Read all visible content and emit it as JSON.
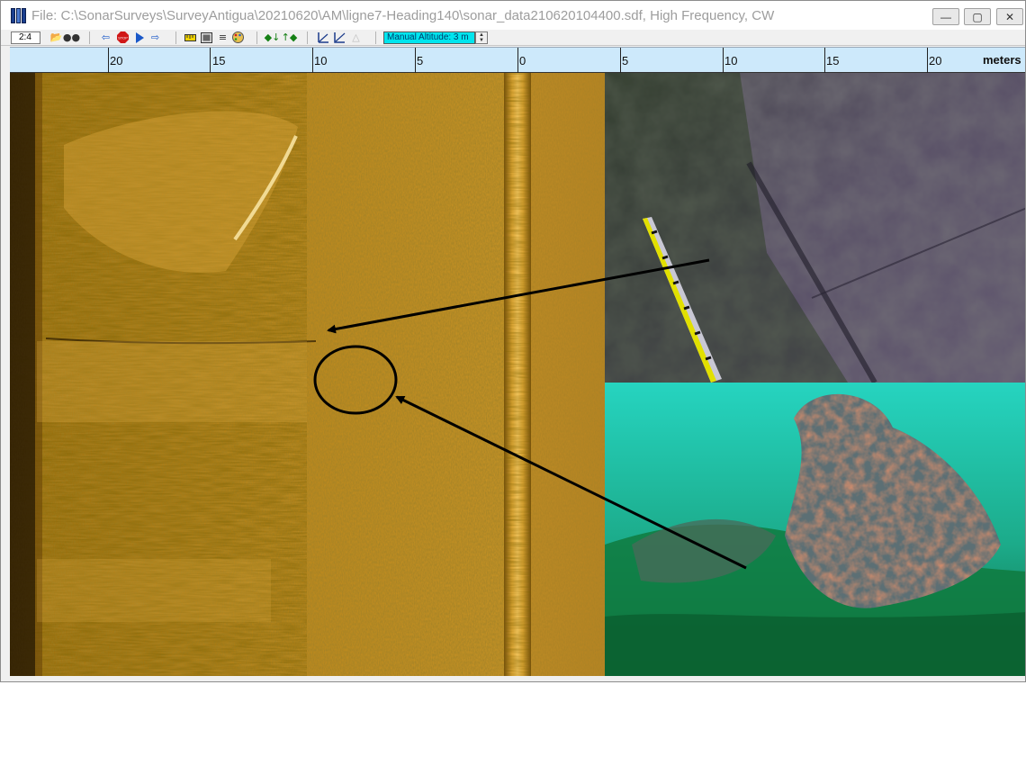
{
  "window": {
    "title": "File: C:\\SonarSurveys\\SurveyAntigua\\20210620\\AM\\ligne7-Heading140\\sonar_data210620104400.sdf, High Frequency, CW",
    "controls": {
      "minimize": "—",
      "maximize": "▢",
      "close": "✕"
    }
  },
  "toolbar": {
    "zoom_value": "2:4",
    "altitude_label": "Manual Altitude: 3 m",
    "spin_up": "▲",
    "spin_down": "▼",
    "icons": [
      "open-file-icon",
      "binoculars-icon",
      "rewind-icon",
      "stop-icon",
      "play-icon",
      "step-forward-icon",
      "ruler-icon",
      "image-icon",
      "equalizer-icon",
      "palette-icon",
      "marker-down-icon",
      "marker-up-icon",
      "measure-icon",
      "angle-icon",
      "layback-icon"
    ]
  },
  "ruler": {
    "units": "meters",
    "labels": [
      "20",
      "15",
      "10",
      "5",
      "0",
      "5",
      "10",
      "15",
      "20"
    ]
  },
  "colors": {
    "sonar_amber": "#c48a1e",
    "sonar_dark": "#3a2606",
    "ruler_bg": "#cde9fb",
    "altitude_bg": "#00e5ee",
    "water_teal": "#22c9b0"
  }
}
